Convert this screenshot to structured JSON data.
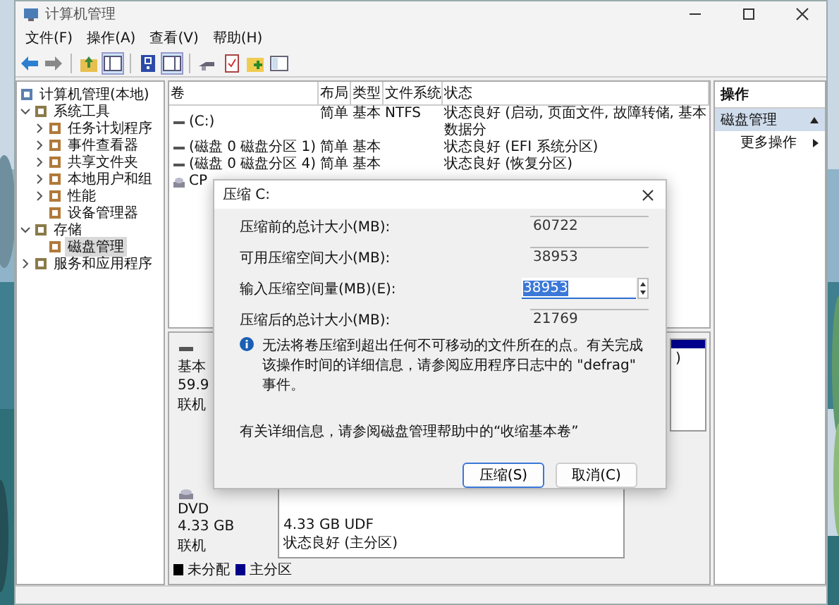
{
  "window": {
    "title": "计算机管理"
  },
  "menu": [
    "文件(F)",
    "操作(A)",
    "查看(V)",
    "帮助(H)"
  ],
  "tree": [
    {
      "label": "计算机管理(本地)",
      "selected": false,
      "children": [
        {
          "label": "系统工具",
          "expanded": true,
          "selected": false,
          "children": [
            {
              "label": "任务计划程序",
              "expanded": false,
              "selected": false
            },
            {
              "label": "事件查看器",
              "expanded": false,
              "selected": false
            },
            {
              "label": "共享文件夹",
              "expanded": false,
              "selected": false
            },
            {
              "label": "本地用户和组",
              "expanded": false,
              "selected": false
            },
            {
              "label": "性能",
              "expanded": false,
              "selected": false
            },
            {
              "label": "设备管理器",
              "selected": false
            }
          ]
        },
        {
          "label": "存储",
          "expanded": true,
          "selected": false,
          "children": [
            {
              "label": "磁盘管理",
              "selected": true
            }
          ]
        },
        {
          "label": "服务和应用程序",
          "expanded": false,
          "selected": false
        }
      ]
    }
  ],
  "volumes": {
    "columns": [
      "卷",
      "布局",
      "类型",
      "文件系统",
      "状态"
    ],
    "rows": [
      {
        "kind": "volume",
        "cells": [
          "(C:)",
          "简单",
          "基本",
          "NTFS",
          "状态良好 (启动, 页面文件, 故障转储, 基本数据分"
        ]
      },
      {
        "kind": "volume",
        "cells": [
          "(磁盘 0 磁盘分区 1)",
          "简单",
          "基本",
          "",
          "状态良好 (EFI 系统分区)"
        ]
      },
      {
        "kind": "volume",
        "cells": [
          "(磁盘 0 磁盘分区 4)",
          "简单",
          "基本",
          "",
          "状态良好 (恢复分区)"
        ]
      },
      {
        "kind": "cd",
        "cells": [
          "CP"
        ]
      }
    ]
  },
  "disks": [
    {
      "kind": "disk",
      "info": [
        "基本",
        "59.9",
        "联机"
      ],
      "partitions": [
        {
          "lines": [
            ")"
          ]
        }
      ]
    },
    {
      "kind": "cd",
      "info": [
        "DVD",
        "4.33 GB",
        "联机"
      ],
      "partitions": [
        {
          "lines": [
            "4.33 GB UDF",
            "状态良好 (主分区)"
          ]
        }
      ]
    }
  ],
  "legend": [
    {
      "label": "未分配",
      "color": "#000000"
    },
    {
      "label": "主分区",
      "color": "#00008b"
    }
  ],
  "actions": {
    "header": "操作",
    "items": [
      {
        "kind": "section",
        "label": "磁盘管理",
        "selected": true
      },
      {
        "kind": "submenu",
        "label": "更多操作",
        "selected": false
      }
    ]
  },
  "dialog": {
    "title": "压缩 C:",
    "fields": [
      {
        "kind": "readonly",
        "label": "压缩前的总计大小(MB):",
        "value": "60722"
      },
      {
        "kind": "readonly",
        "label": "可用压缩空间大小(MB):",
        "value": "38953"
      },
      {
        "kind": "input",
        "label": "输入压缩空间量(MB)(E):",
        "value": "38953"
      },
      {
        "kind": "readonly",
        "label": "压缩后的总计大小(MB):",
        "value": "21769"
      }
    ],
    "info": "无法将卷压缩到超出任何不可移动的文件所在的点。有关完成该操作时间的详细信息，请参阅应用程序日志中的 \"defrag\" 事件。",
    "help": "有关详细信息，请参阅磁盘管理帮助中的“收缩基本卷”",
    "buttons": [
      {
        "label": "压缩(S)",
        "default": true
      },
      {
        "label": "取消(C)",
        "default": false
      }
    ]
  }
}
